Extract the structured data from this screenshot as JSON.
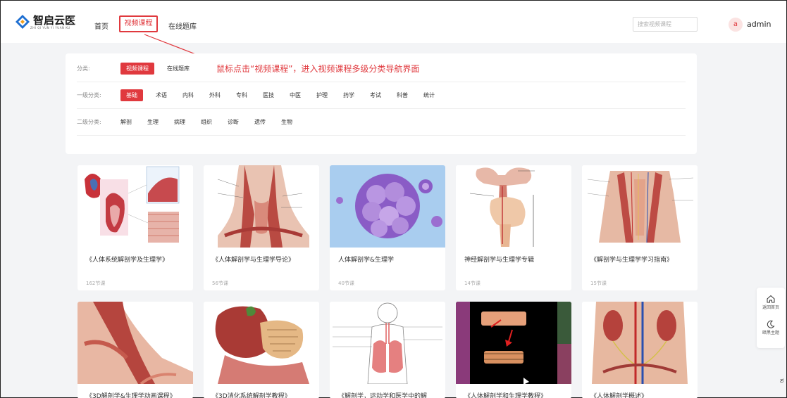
{
  "header": {
    "logo_text": "智启云医",
    "logo_sub": "ZHI QI YUN YI YUAN KU",
    "nav": [
      "首页",
      "视频课程",
      "在线题库"
    ],
    "search_placeholder": "搜索视频课程",
    "avatar_letter": "a",
    "username": "admin"
  },
  "annotation": "鼠标点击“视频课程”，进入视频课程多级分类导航界面",
  "filters": {
    "category": {
      "label": "分类:",
      "options": [
        "视频课程",
        "在线题库"
      ]
    },
    "level1": {
      "label": "一级分类:",
      "options": [
        "基础",
        "术语",
        "内科",
        "外科",
        "专科",
        "医技",
        "中医",
        "护理",
        "药学",
        "考试",
        "科普",
        "统计"
      ]
    },
    "level2": {
      "label": "二级分类:",
      "options": [
        "解剖",
        "生理",
        "病理",
        "组织",
        "诊断",
        "遗传",
        "生物"
      ]
    }
  },
  "courses": [
    {
      "title": "《人体系统解剖学及生理学》",
      "lessons": "162节课"
    },
    {
      "title": "《人体解剖学与生理学导论》",
      "lessons": "56节课"
    },
    {
      "title": "人体解剖学&生理学",
      "lessons": "40节课"
    },
    {
      "title": "神经解剖学与生理学专辑",
      "lessons": "14节课"
    },
    {
      "title": "《解剖学与生理学学习指南》",
      "lessons": "15节课"
    },
    {
      "title": "《3D解剖学&生理学动画课程》",
      "lessons": ""
    },
    {
      "title": "《3D消化系统解剖学教程》",
      "lessons": ""
    },
    {
      "title": "《解剖学，运动学和医学中的解",
      "lessons": ""
    },
    {
      "title": "《人体解剖学和生理学教程》",
      "lessons": ""
    },
    {
      "title": "《人体解剖学概述》",
      "lessons": ""
    }
  ],
  "side": {
    "home": "返回首页",
    "theme": "暗黑主题"
  },
  "colors": {
    "accent": "#e0393e",
    "logo_blue": "#1e6fd1"
  },
  "icons": [
    "logo-icon",
    "home-icon",
    "moon-icon"
  ]
}
